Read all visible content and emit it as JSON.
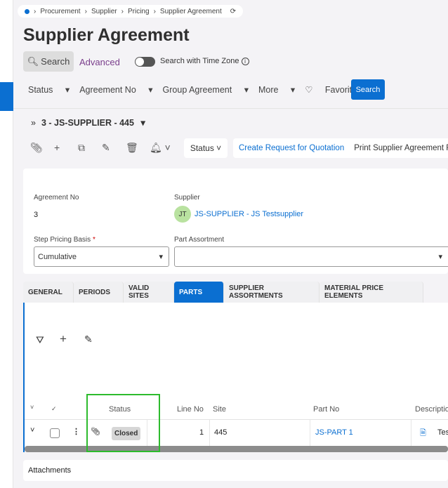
{
  "breadcrumb": [
    "Procurement",
    "Supplier",
    "Pricing",
    "Supplier Agreement"
  ],
  "page_title": "Supplier Agreement",
  "search": {
    "search_label": "Search",
    "advanced_label": "Advanced",
    "timezone_label": "Search with Time Zone",
    "timezone_on": false
  },
  "filters": [
    "Status",
    "Agreement No",
    "Group Agreement",
    "More"
  ],
  "favorites_label": "Favorites",
  "search_button": "Search",
  "record_title": "3 - JS-SUPPLIER - 445",
  "toolbar": {
    "status_label": "Status",
    "create_rfq": "Create Request for Quotation",
    "print": "Print Supplier Agreement R"
  },
  "form": {
    "agreement_no_label": "Agreement No",
    "agreement_no": "3",
    "supplier_label": "Supplier",
    "supplier_initials": "JT",
    "supplier": "JS-SUPPLIER - JS Testsupplier",
    "step_pricing_label": "Step Pricing Basis",
    "required_mark": "*",
    "step_pricing": "Cumulative",
    "part_assortment_label": "Part Assortment",
    "part_assortment": ""
  },
  "tabs": [
    "GENERAL",
    "PERIODS",
    "VALID SITES",
    "PARTS",
    "SUPPLIER ASSORTMENTS",
    "MATERIAL PRICE ELEMENTS"
  ],
  "active_tab": "PARTS",
  "grid": {
    "columns": {
      "status": "Status",
      "line_no": "Line No",
      "site": "Site",
      "part_no": "Part No",
      "description": "Description"
    },
    "rows": [
      {
        "status": "Closed",
        "line_no": "1",
        "site": "445",
        "part_no": "JS-PART 1",
        "description": "Tes"
      }
    ]
  },
  "attachments_label": "Attachments",
  "colors": {
    "accent": "#0b6fd1",
    "highlight": "#2dbb2d"
  }
}
